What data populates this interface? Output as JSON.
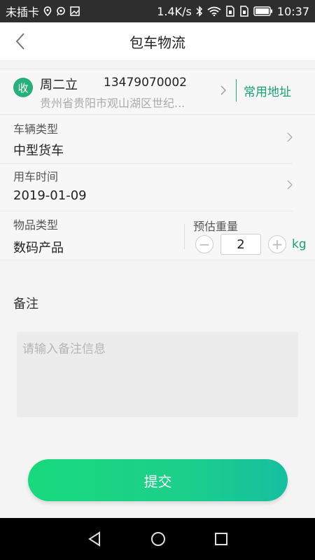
{
  "status_bar": {
    "carrier": "未插卡",
    "speed": "1.4K/s",
    "time": "10:37",
    "icons": [
      "location-icon",
      "message-icon",
      "image-icon",
      "bluetooth-icon",
      "wifi-icon",
      "sim-icon",
      "sim-icon",
      "battery-icon"
    ]
  },
  "header": {
    "title": "包车物流",
    "back_icon": "chevron-left-icon"
  },
  "receiver": {
    "badge": "收",
    "name": "周二立",
    "phone": "13479070002",
    "address": "贵州省贵阳市观山湖区世纪...",
    "common_address_label": "常用地址"
  },
  "form": {
    "vehicle_type": {
      "label": "车辆类型",
      "value": "中型货车"
    },
    "use_time": {
      "label": "用车时间",
      "value": "2019-01-09"
    },
    "goods_type": {
      "label": "物品类型",
      "value": "数码产品"
    },
    "weight": {
      "label": "预估重量",
      "value": "2",
      "unit": "kg",
      "minus": "−",
      "plus": "+"
    }
  },
  "remark": {
    "label": "备注",
    "placeholder": "请输入备注信息"
  },
  "submit": {
    "label": "提交"
  },
  "colors": {
    "accent": "#1aa074",
    "badge": "#28b07a",
    "button_start": "#18d97d",
    "button_end": "#16bfa0"
  }
}
